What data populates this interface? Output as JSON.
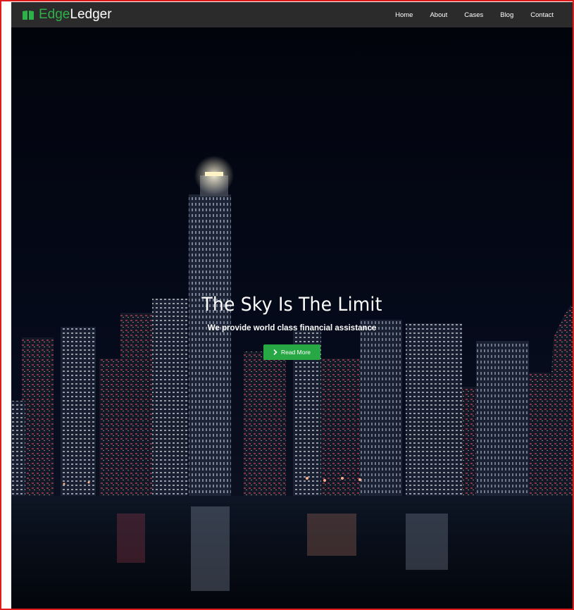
{
  "brand": {
    "part1": "Edge",
    "part2": "Ledger",
    "accent": "#2db24a"
  },
  "nav": {
    "items": [
      {
        "label": "Home"
      },
      {
        "label": "About"
      },
      {
        "label": "Cases"
      },
      {
        "label": "Blog"
      },
      {
        "label": "Contact"
      }
    ]
  },
  "hero": {
    "title": "The Sky Is The Limit",
    "subtitle": "We provide world class financial assistance",
    "cta_label": "Read More",
    "cta_icon": "chevron-right-icon",
    "cta_color": "#28a745"
  }
}
